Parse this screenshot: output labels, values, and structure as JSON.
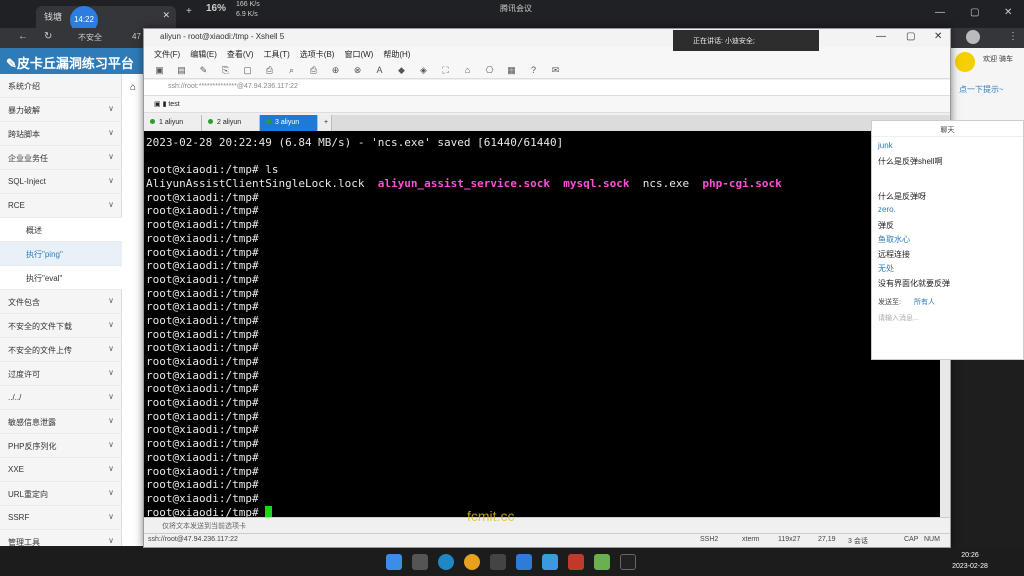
{
  "browser": {
    "tab1_label": "钱塘",
    "badge_time": "14:22",
    "net_up": "166 K/s",
    "net_down": "6.9 K/s",
    "net_percent": "16%",
    "meeting_label": "腾讯会议",
    "insecure_label": "不安全",
    "addr_prefix": "47"
  },
  "site": {
    "title": "皮卡丘漏洞练习平台",
    "sidebar": [
      {
        "label": "系统介绍",
        "chev": ""
      },
      {
        "label": "暴力破解",
        "chev": "∨"
      },
      {
        "label": "跨站脚本",
        "chev": "∨"
      },
      {
        "label": "企业业务任",
        "chev": "∨"
      },
      {
        "label": "SQL-Inject",
        "chev": "∨"
      },
      {
        "label": "RCE",
        "chev": "∨"
      },
      {
        "label": "概述",
        "chev": ""
      },
      {
        "label": "执行\"ping\"",
        "chev": ""
      },
      {
        "label": "执行\"eval\"",
        "chev": ""
      },
      {
        "label": "文件包含",
        "chev": "∨"
      },
      {
        "label": "不安全的文件下载",
        "chev": "∨"
      },
      {
        "label": "不安全的文件上传",
        "chev": "∨"
      },
      {
        "label": "过度许可",
        "chev": "∨"
      },
      {
        "label": "../../",
        "chev": "∨"
      },
      {
        "label": "敏感信息泄露",
        "chev": "∨"
      },
      {
        "label": "PHP反序列化",
        "chev": "∨"
      },
      {
        "label": "XXE",
        "chev": "∨"
      },
      {
        "label": "URL重定向",
        "chev": "∨"
      },
      {
        "label": "SSRF",
        "chev": "∨"
      },
      {
        "label": "管理工具",
        "chev": "∨"
      }
    ]
  },
  "xshell": {
    "title": "aliyun - root@xiaodi:/tmp - Xshell 5",
    "menu": [
      "文件(F)",
      "编辑(E)",
      "查看(V)",
      "工具(T)",
      "选项卡(B)",
      "窗口(W)",
      "帮助(H)"
    ],
    "address": "ssh://root:**************@47.94.236.117:22",
    "link_label": "test",
    "tabs": [
      {
        "label": "1 aliyun"
      },
      {
        "label": "2 aliyun"
      },
      {
        "label": "3 aliyun"
      }
    ],
    "compose_placeholder": "仅将文本发送到当前选项卡",
    "status": {
      "conn": "ssh://root@47.94.236.117:22",
      "proto": "SSH2",
      "term": "xterm",
      "size": "119x27",
      "pos": "27,19",
      "sessions": "3 会话",
      "caps": "CAP",
      "num": "NUM"
    }
  },
  "terminal": {
    "line0": "2023-02-28 20:22:49 (6.84 MB/s) - 'ncs.exe' saved [61440/61440]",
    "line1": "",
    "line2": "root@xiaodi:/tmp# ls",
    "ls_files": [
      {
        "name": "AliyunAssistClientSingleLock.lock",
        "hl": false
      },
      {
        "name": "aliyun_assist_service.sock",
        "hl": true
      },
      {
        "name": "mysql.sock",
        "hl": true
      },
      {
        "name": "ncs.exe",
        "hl": false
      },
      {
        "name": "php-cgi.sock",
        "hl": true
      }
    ],
    "prompt": "root@xiaodi:/tmp#",
    "prompt_count": 24
  },
  "chat": {
    "title": "聊天",
    "lines": [
      {
        "text": "junk",
        "name": true
      },
      {
        "text": "什么是反弹shell啊",
        "name": false
      },
      {
        "text": "",
        "name": false
      },
      {
        "text": "什么是反弹呀",
        "name": false
      },
      {
        "text": "zero.",
        "name": true
      },
      {
        "text": "弹反",
        "name": false
      },
      {
        "text": "鱼取水心",
        "name": true
      },
      {
        "text": "远程连接",
        "name": false
      },
      {
        "text": "无处",
        "name": true
      },
      {
        "text": "没有界面化就要反弹",
        "name": false
      }
    ],
    "send_to_label": "发送至:",
    "send_to_value": "所有人",
    "input_placeholder": "请输入消息..."
  },
  "speaking": "正在讲话: 小迪安全;",
  "right_panel": {
    "welcome": "欢迎 骑车",
    "link": "点一下提示~"
  },
  "watermark": "fcmit.cc",
  "clock": {
    "time": "20:26",
    "date": "2023-02-28"
  }
}
